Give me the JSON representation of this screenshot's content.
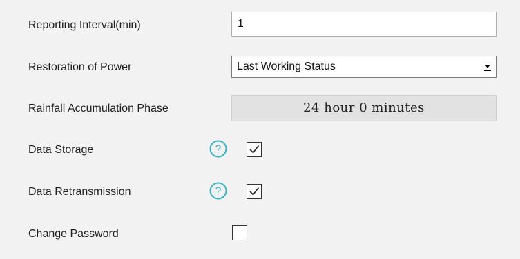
{
  "fields": {
    "reporting_interval": {
      "label": "Reporting Interval(min)",
      "value": "1"
    },
    "restoration_of_power": {
      "label": "Restoration of Power",
      "selected": "Last Working Status"
    },
    "rainfall_accumulation_phase": {
      "label": "Rainfall Accumulation Phase",
      "value": "24 hour 0 minutes"
    },
    "data_storage": {
      "label": "Data Storage",
      "checked": true,
      "help_icon": "question-circle-icon"
    },
    "data_retransmission": {
      "label": "Data Retransmission",
      "checked": true,
      "help_icon": "question-circle-icon"
    },
    "change_password": {
      "label": "Change Password",
      "checked": false
    }
  },
  "colors": {
    "help_icon": "#3bb3c6",
    "background": "#f2f2f2"
  }
}
